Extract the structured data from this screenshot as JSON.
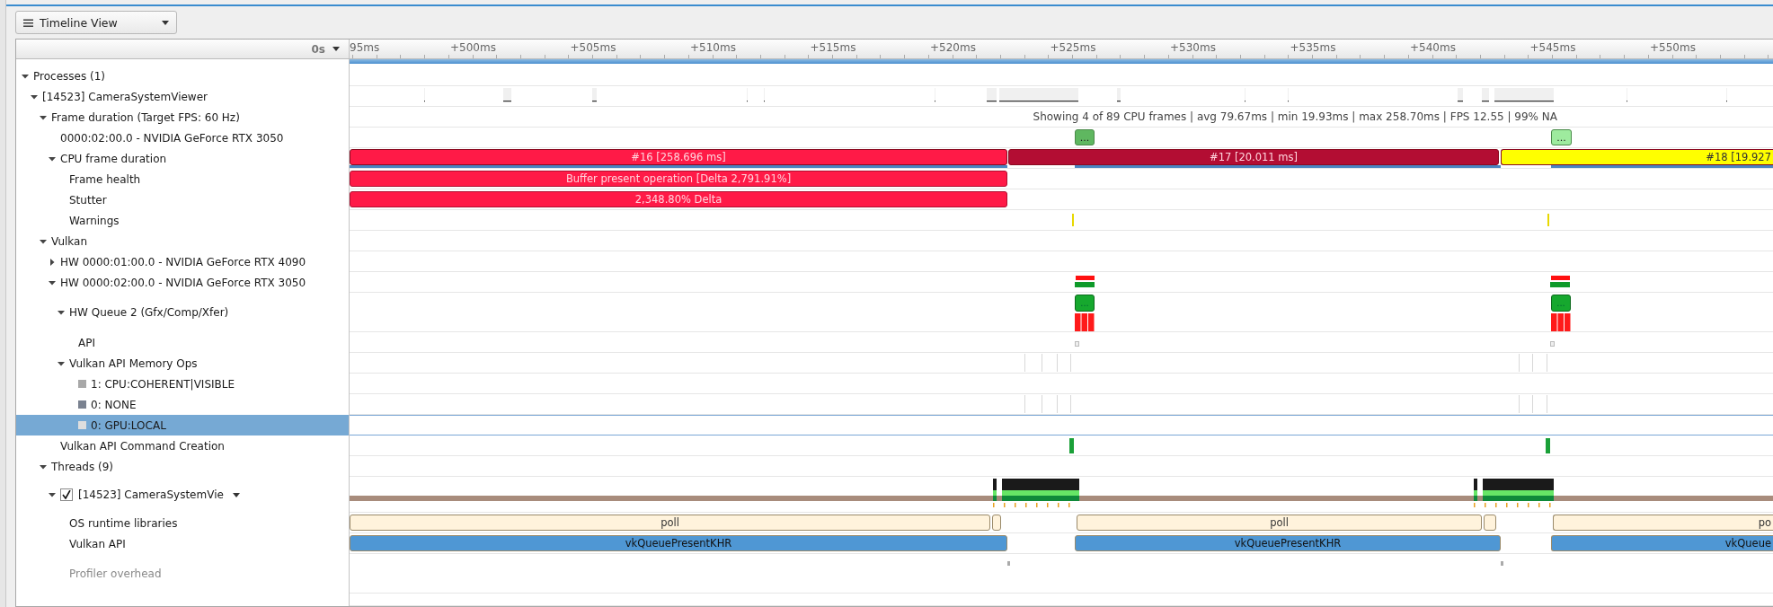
{
  "toolbar": {
    "view_button": "Timeline View"
  },
  "header": {
    "time_origin": "0s",
    "ruler_labels": [
      "95ms",
      "+500ms",
      "+505ms",
      "+510ms",
      "+515ms",
      "+520ms",
      "+525ms",
      "+530ms",
      "+535ms",
      "+540ms",
      "+545ms",
      "+550ms"
    ]
  },
  "tree": [
    {
      "label": "Processes (1)",
      "expanded": true,
      "selected": false,
      "disabled": false,
      "children": [
        {
          "label": "[14523] CameraSystemViewer",
          "expanded": true,
          "selected": false,
          "disabled": false,
          "track": {
            "kind": "usage"
          },
          "children": [
            {
              "label": "Frame duration (Target FPS: 60 Hz)",
              "expanded": true,
              "selected": false,
              "disabled": false,
              "track": {
                "kind": "summary",
                "text": "Showing 4 of 89 CPU frames | avg 79.67ms | min 19.93ms | max 258.70ms | FPS 12.55 | 99% NA"
              },
              "children": [
                {
                  "label": "0000:02:00.0 - NVIDIA GeForce RTX 3050",
                  "selected": false,
                  "disabled": false,
                  "track": {
                    "kind": "markers",
                    "items": [
                      {
                        "label": "...",
                        "color": "#5fb760"
                      },
                      {
                        "label": "...",
                        "color": "#9eeb9e"
                      }
                    ]
                  }
                },
                {
                  "label": "CPU frame duration",
                  "expanded": true,
                  "selected": false,
                  "disabled": false,
                  "track": {
                    "kind": "frames",
                    "items": [
                      {
                        "label": "#16 [258.696 ms]",
                        "color": "#ff1a47"
                      },
                      {
                        "label": "#17 [20.011 ms]",
                        "color": "#b30d33"
                      },
                      {
                        "label": "#18 [19.927",
                        "color": "#ffff00"
                      }
                    ]
                  },
                  "children": [
                    {
                      "label": "Frame health",
                      "selected": false,
                      "disabled": false,
                      "track": {
                        "kind": "events",
                        "items": [
                          {
                            "label": "Buffer present operation [Delta 2,791.91%]"
                          }
                        ]
                      }
                    },
                    {
                      "label": "Stutter",
                      "selected": false,
                      "disabled": false,
                      "track": {
                        "kind": "events",
                        "items": [
                          {
                            "label": "2,348.80% Delta"
                          }
                        ]
                      }
                    },
                    {
                      "label": "Warnings",
                      "selected": false,
                      "disabled": false,
                      "track": {
                        "kind": "warnings"
                      }
                    }
                  ]
                }
              ]
            },
            {
              "label": "Vulkan",
              "expanded": true,
              "selected": false,
              "disabled": false,
              "children": [
                {
                  "label": "HW 0000:01:00.0 - NVIDIA GeForce RTX 4090",
                  "expanded": false,
                  "selected": false,
                  "disabled": false
                },
                {
                  "label": "HW 0000:02:00.0 - NVIDIA GeForce RTX 3050",
                  "expanded": true,
                  "selected": false,
                  "disabled": false,
                  "track": {
                    "kind": "gpu"
                  },
                  "children": [
                    {
                      "label": "HW Queue 2 (Gfx/Comp/Xfer)",
                      "expanded": true,
                      "selected": false,
                      "disabled": false,
                      "track": {
                        "kind": "queue",
                        "items": [
                          {
                            "label": "..."
                          },
                          {
                            "label": "..."
                          }
                        ]
                      },
                      "children": [
                        {
                          "label": "API",
                          "selected": false,
                          "disabled": false,
                          "track": {
                            "kind": "api-marks"
                          }
                        }
                      ]
                    },
                    {
                      "label": "Vulkan API Memory Ops",
                      "expanded": true,
                      "selected": false,
                      "disabled": false,
                      "track": {
                        "kind": "faint"
                      },
                      "children": [
                        {
                          "label": "1: CPU:COHERENT|VISIBLE",
                          "color": "#a8a8a8",
                          "selected": false,
                          "disabled": false
                        },
                        {
                          "label": "0: NONE",
                          "color": "#7a8290",
                          "selected": false,
                          "disabled": false,
                          "track": {
                            "kind": "faint"
                          }
                        },
                        {
                          "label": "0: GPU:LOCAL",
                          "color": "#dedede",
                          "selected": true,
                          "disabled": false
                        }
                      ]
                    }
                  ]
                },
                {
                  "label": "Vulkan API Command Creation",
                  "selected": false,
                  "disabled": false,
                  "track": {
                    "kind": "commands"
                  }
                }
              ]
            },
            {
              "label": "Threads (9)",
              "expanded": true,
              "selected": false,
              "disabled": false,
              "children": [
                {
                  "label": "[14523] CameraSystemVie",
                  "expanded": true,
                  "checked": true,
                  "selected": false,
                  "disabled": false,
                  "track": {
                    "kind": "thread"
                  },
                  "children": [
                    {
                      "label": "OS runtime libraries",
                      "selected": false,
                      "disabled": false,
                      "track": {
                        "kind": "calls",
                        "items": [
                          {
                            "label": "poll",
                            "color": "#fff3dc"
                          },
                          {
                            "color": "#fff3dc"
                          },
                          {
                            "label": "poll",
                            "color": "#fff3dc"
                          },
                          {
                            "color": "#fff3dc"
                          },
                          {
                            "label": "po",
                            "color": "#fff3dc"
                          }
                        ]
                      }
                    },
                    {
                      "label": "Vulkan API",
                      "selected": false,
                      "disabled": false,
                      "track": {
                        "kind": "calls",
                        "items": [
                          {
                            "label": "vkQueuePresentKHR",
                            "color": "#4f97d4"
                          },
                          {
                            "label": "vkQueuePresentKHR",
                            "color": "#4f97d4"
                          },
                          {
                            "label": "vkQueue",
                            "color": "#4f97d4"
                          }
                        ]
                      }
                    },
                    {
                      "label": "Profiler overhead",
                      "selected": false,
                      "disabled": true,
                      "track": {
                        "kind": "overhead"
                      }
                    }
                  ]
                }
              ]
            }
          ]
        }
      ]
    }
  ]
}
